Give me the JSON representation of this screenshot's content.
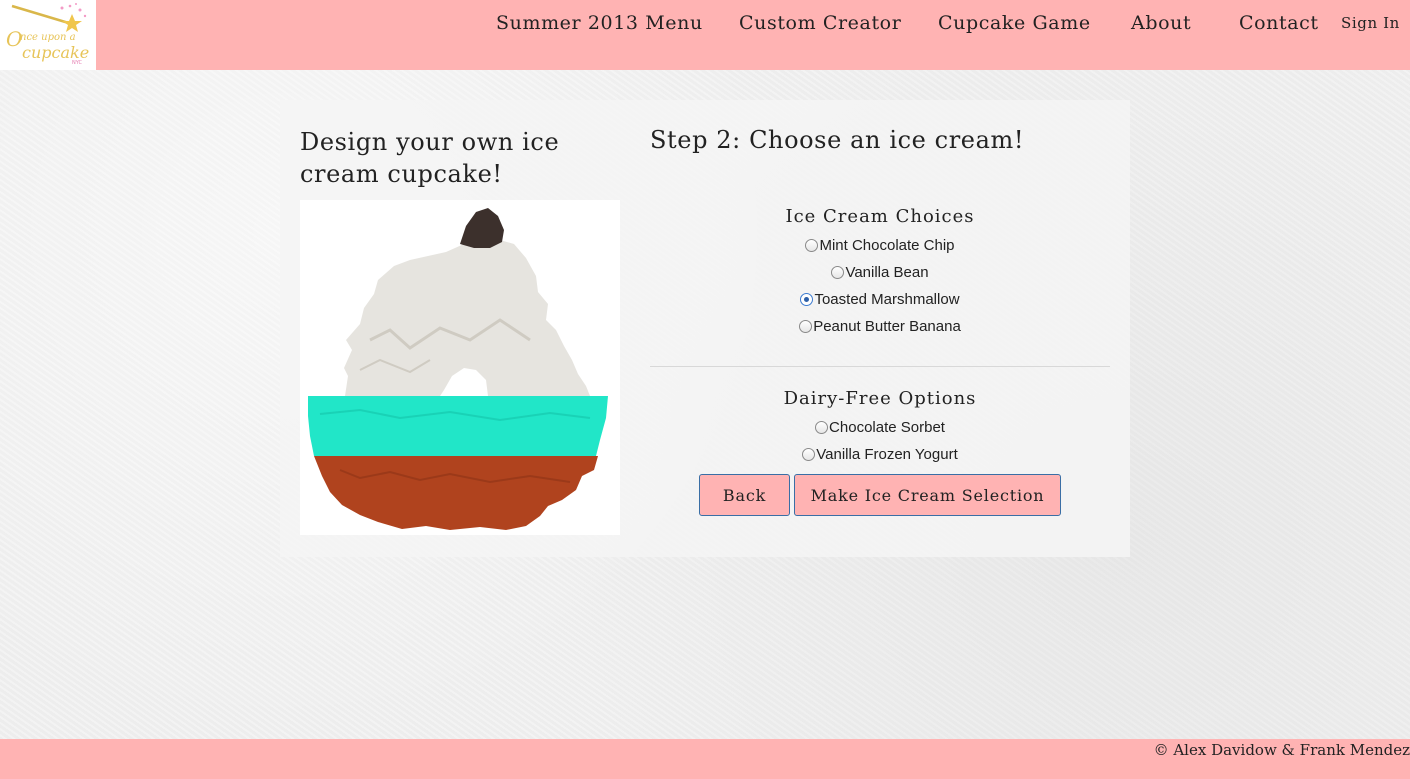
{
  "header": {
    "logo_text": "Once upon a Cupcake NYC",
    "nav": [
      "Summer 2013 Menu",
      "Custom Creator",
      "Cupcake Game",
      "About",
      "Contact"
    ],
    "signin": "Sign In"
  },
  "designer": {
    "title": "Design your own ice cream cupcake!",
    "step_title": "Step 2: Choose an ice cream!"
  },
  "ice_cream": {
    "title": "Ice Cream Choices",
    "options": [
      {
        "label": "Mint Chocolate Chip",
        "checked": false
      },
      {
        "label": "Vanilla Bean",
        "checked": false
      },
      {
        "label": "Toasted Marshmallow",
        "checked": true
      },
      {
        "label": "Peanut Butter Banana",
        "checked": false
      }
    ]
  },
  "dairy_free": {
    "title": "Dairy-Free Options",
    "options": [
      {
        "label": "Chocolate Sorbet",
        "checked": false
      },
      {
        "label": "Vanilla Frozen Yogurt",
        "checked": false
      }
    ]
  },
  "buttons": {
    "back": "Back",
    "submit": "Make Ice Cream Selection"
  },
  "footer": {
    "copyright": "© Alex Davidow & Frank Mendez"
  },
  "colors": {
    "brand_pink": "#ffb3b3",
    "mint": "#21e6c8",
    "cake": "#b0431e",
    "marshmallow": "#e6e4df",
    "radio_selected": "#2c5fa8"
  }
}
